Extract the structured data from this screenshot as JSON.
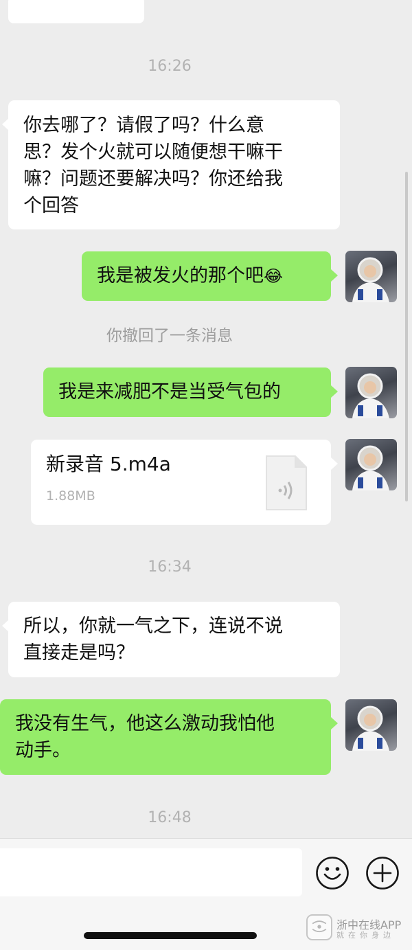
{
  "messages": {
    "time_1": "16:26",
    "msg_1": [
      "你去哪了？请假了吗？什么意",
      "思？发个火就可以随便想干嘛干",
      "嘛？问题还要解决吗？你还给我",
      "个回答"
    ],
    "msg_2": "我是被发火的那个吧",
    "msg_2_emoji": "😂",
    "recall_notice": "你撤回了一条消息",
    "msg_3": "我是来减肥不是当受气包的",
    "file": {
      "name": "新录音 5.m4a",
      "size": "1.88MB",
      "icon": "audio-file-icon"
    },
    "time_2": "16:34",
    "msg_4": [
      "所以，你就一气之下，连说不说",
      "直接走是吗？"
    ],
    "msg_5": [
      "我没有生气，他这么激动我怕他",
      "动手。"
    ],
    "time_3": "16:48"
  },
  "input_bar": {
    "icons": [
      "emoji-icon",
      "plus-icon"
    ]
  },
  "watermark": {
    "name": "浙中在线APP",
    "slogan": "就在你身边"
  },
  "colors": {
    "background": "#ededed",
    "incoming": "#ffffff",
    "outgoing": "#95ec69"
  }
}
